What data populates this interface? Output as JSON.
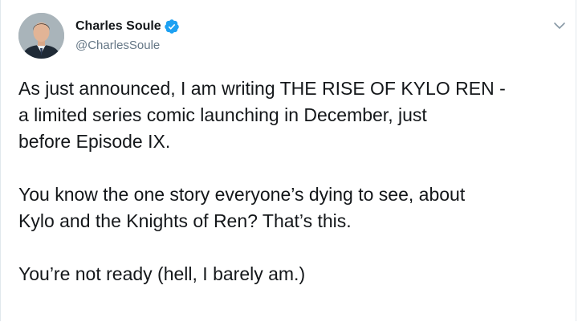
{
  "tweet": {
    "author": {
      "display_name": "Charles Soule",
      "handle": "@CharlesSoule",
      "verified": true
    },
    "paragraphs": [
      {
        "lines": [
          "As just announced, I am writing THE RISE OF KYLO REN -",
          "a limited series comic launching in December, just",
          "before Episode IX."
        ]
      },
      {
        "lines": [
          "You know the one story everyone’s dying to see, about",
          "Kylo and the Knights of Ren? That’s this."
        ]
      },
      {
        "lines": [
          "You’re not ready (hell, I barely am.)"
        ]
      }
    ]
  },
  "icons": {
    "verified": "verified-badge-icon",
    "caret": "chevron-down-icon"
  },
  "colors": {
    "text_primary": "#14171a",
    "text_secondary": "#657786",
    "verified_blue": "#1da1f2",
    "border": "#e1e8ed"
  }
}
